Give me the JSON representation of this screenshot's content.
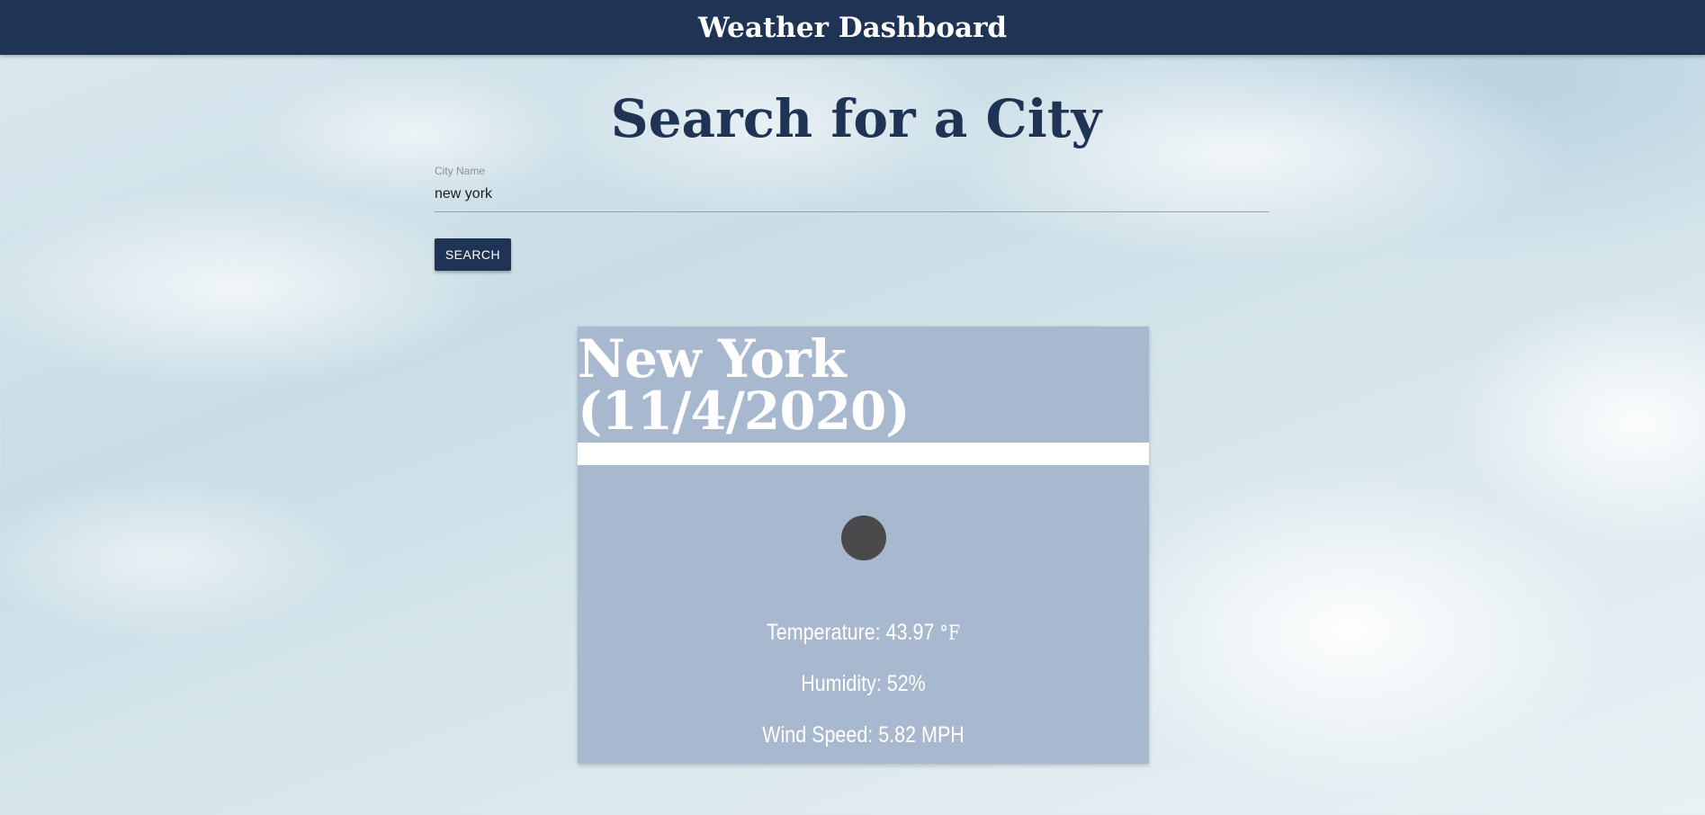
{
  "header": {
    "title": "Weather Dashboard"
  },
  "search": {
    "heading": "Search for a City",
    "field_label": "City Name",
    "field_value": "new york",
    "button_label": "SEARCH"
  },
  "weather": {
    "title": "New York (11/4/2020)",
    "icon": "weather-condition-icon",
    "temperature_label": "Temperature: 43.97",
    "temperature_unit": "°F",
    "humidity": "Humidity: 52%",
    "wind_speed": "Wind Speed: 5.82 MPH"
  },
  "colors": {
    "primary": "#1f3454",
    "card_background": "#a8b8cf",
    "icon": "#4a4a4c"
  }
}
